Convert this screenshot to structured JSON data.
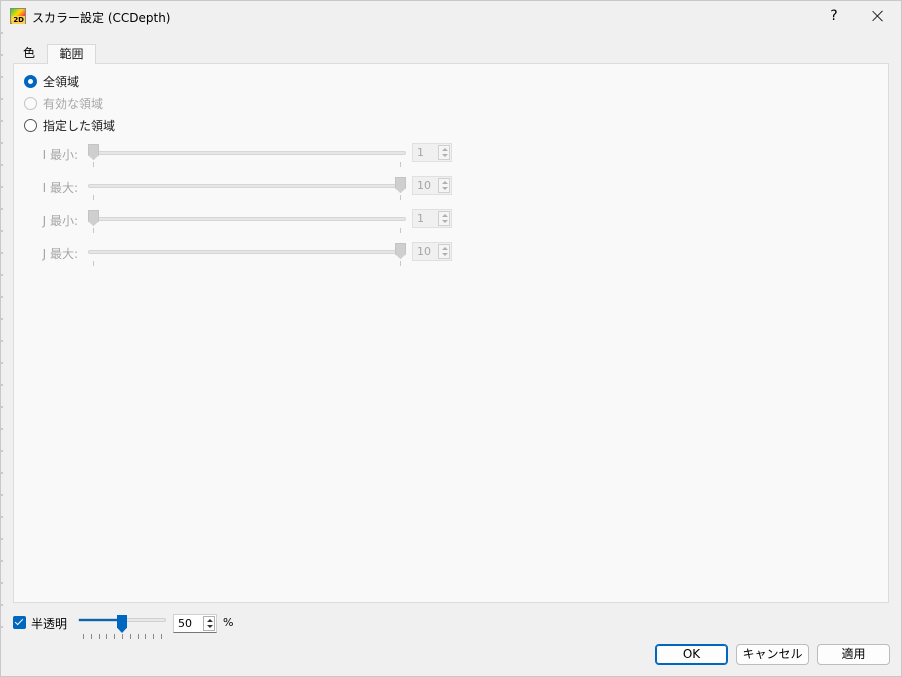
{
  "window": {
    "title": "スカラー設定 (CCDepth)",
    "icon_label": "2D",
    "help_label": "?",
    "close_icon": "close-icon"
  },
  "tabs": [
    {
      "label": "色",
      "active": false
    },
    {
      "label": "範囲",
      "active": true
    }
  ],
  "range": {
    "options": [
      {
        "label": "全領域",
        "checked": true,
        "enabled": true
      },
      {
        "label": "有効な領域",
        "checked": false,
        "enabled": false
      },
      {
        "label": "指定した領域",
        "checked": false,
        "enabled": true
      }
    ],
    "sliders": [
      {
        "label": "I 最小:",
        "value": "1",
        "min": 1,
        "max": 10
      },
      {
        "label": "I 最大:",
        "value": "10",
        "min": 1,
        "max": 10
      },
      {
        "label": "J 最小:",
        "value": "1",
        "min": 1,
        "max": 10
      },
      {
        "label": "J 最大:",
        "value": "10",
        "min": 1,
        "max": 10
      }
    ]
  },
  "translucency": {
    "label": "半透明",
    "checked": true,
    "value": "50",
    "unit": "%",
    "fraction": 0.5,
    "accent_color": "#0067c0"
  },
  "buttons": {
    "ok": "OK",
    "cancel": "キャンセル",
    "apply": "適用"
  }
}
